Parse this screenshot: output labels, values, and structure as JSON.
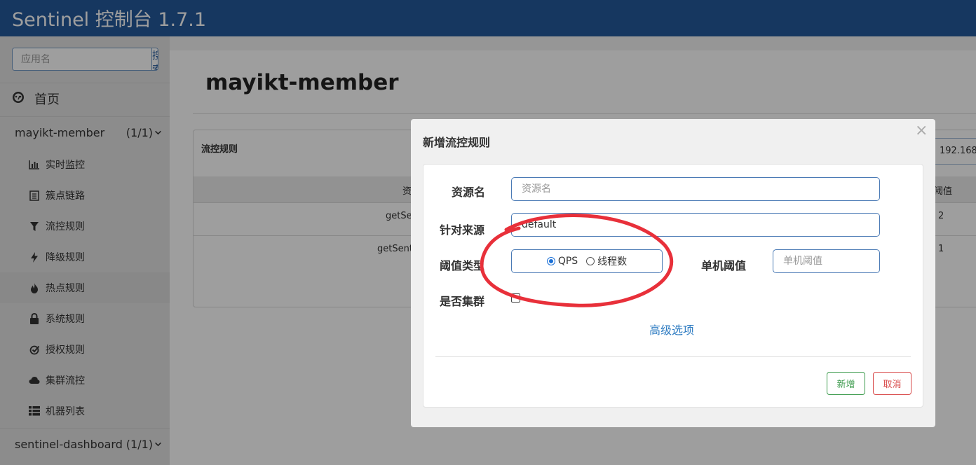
{
  "header": {
    "brand": "Sentinel 控制台 1.7.1"
  },
  "sidebar": {
    "search_placeholder": "应用名",
    "search_button": "搜索",
    "home_label": "首页",
    "apps": [
      {
        "name": "mayikt-member",
        "count": "(1/1)"
      },
      {
        "name": "sentinel-dashboard",
        "count": "(1/1)"
      }
    ],
    "items": [
      {
        "label": "实时监控",
        "icon": "bar-chart-icon"
      },
      {
        "label": "簇点链路",
        "icon": "list-doc-icon"
      },
      {
        "label": "流控规则",
        "icon": "filter-icon"
      },
      {
        "label": "降级规则",
        "icon": "bolt-icon"
      },
      {
        "label": "热点规则",
        "icon": "fire-icon"
      },
      {
        "label": "系统规则",
        "icon": "lock-icon"
      },
      {
        "label": "授权规则",
        "icon": "check-circle-icon"
      },
      {
        "label": "集群流控",
        "icon": "cloud-icon"
      },
      {
        "label": "机器列表",
        "icon": "list-icon"
      }
    ]
  },
  "main": {
    "title": "mayikt-member",
    "panel_title": "流控规则",
    "ip": "192.168",
    "table": {
      "col_resource": "资",
      "col_threshold": "阈值",
      "rows": [
        {
          "resource": "getSer",
          "threshold": "2"
        },
        {
          "resource": "getSenti",
          "threshold": "1"
        }
      ]
    }
  },
  "modal": {
    "title": "新增流控规则",
    "close": "×",
    "resource_label": "资源名",
    "resource_placeholder": "资源名",
    "source_label": "针对来源",
    "source_value": "default",
    "threshold_type_label": "阈值类型",
    "radio_qps": "QPS",
    "radio_threads": "线程数",
    "single_threshold_label": "单机阈值",
    "single_threshold_placeholder": "单机阈值",
    "cluster_label": "是否集群",
    "advanced_link": "高级选项",
    "add_button": "新增",
    "cancel_button": "取消"
  },
  "colors": {
    "header_bg": "#255a9c",
    "link": "#2f7cc2",
    "success": "#3d9b4d",
    "danger": "#d84a4a",
    "annotation": "#e8303a"
  }
}
